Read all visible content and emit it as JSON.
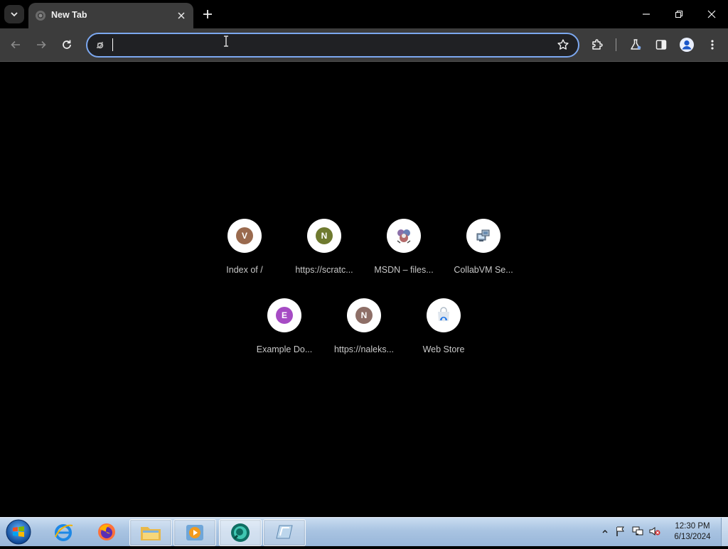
{
  "browser": {
    "tab": {
      "title": "New Tab"
    },
    "omnibox": {
      "value": "",
      "placeholder": ""
    }
  },
  "shortcuts": [
    {
      "label": "Index of /",
      "letter": "V",
      "color": "#9a6a4e"
    },
    {
      "label": "https://scratc...",
      "letter": "N",
      "color": "#6f7a2f"
    },
    {
      "label": "MSDN – files...",
      "letter": "",
      "color": ""
    },
    {
      "label": "CollabVM Se...",
      "letter": "",
      "color": ""
    },
    {
      "label": "Example Do...",
      "letter": "E",
      "color": "#a64bc4"
    },
    {
      "label": "https://naleks...",
      "letter": "N",
      "color": "#8e6f67"
    },
    {
      "label": "Web Store",
      "letter": "",
      "color": ""
    }
  ],
  "taskbar": {
    "items": [
      "internet-explorer",
      "firefox",
      "file-explorer",
      "media-player",
      "chrome-app",
      "window-app"
    ]
  },
  "clock": {
    "time": "12:30 PM",
    "date": "6/13/2024"
  },
  "colors": {
    "accent": "#7ca8f0",
    "toolbar": "#3c3c3c",
    "background": "#000000"
  }
}
